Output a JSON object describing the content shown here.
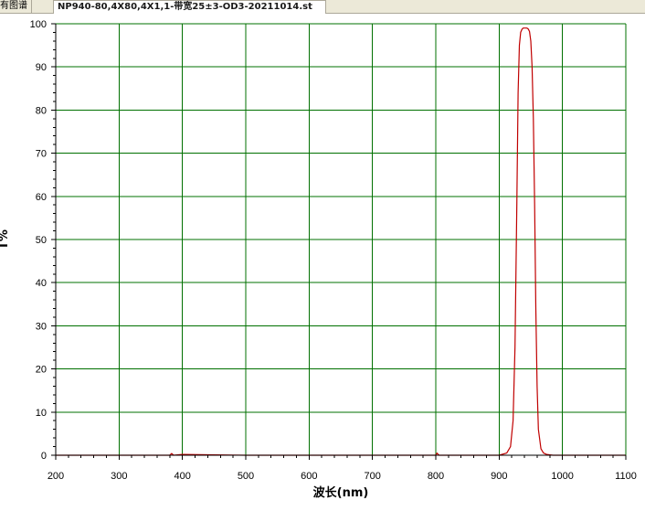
{
  "tabs": {
    "prev_tab_label": "有图谱",
    "active_tab_label": "NP940-80,4X80,4X1,1-带宽25±3-OD3-20211014.st"
  },
  "colors": {
    "grid": "#007000",
    "curve": "#c00000",
    "axis": "#000000"
  },
  "chart_data": {
    "type": "line",
    "title": "",
    "xlabel": "波长(nm)",
    "ylabel": "T%",
    "xlim": [
      200,
      1100
    ],
    "ylim": [
      0,
      100
    ],
    "x_ticks": [
      200,
      300,
      400,
      500,
      600,
      700,
      800,
      900,
      1000,
      1100
    ],
    "y_ticks": [
      0,
      10,
      20,
      30,
      40,
      50,
      60,
      70,
      80,
      90,
      100
    ],
    "grid": true,
    "series": [
      {
        "x": [
          200,
          300,
          380,
          383,
          386,
          400,
          500,
          600,
          700,
          800,
          802,
          805,
          900,
          912,
          918,
          922,
          925,
          928,
          930,
          932,
          934,
          936,
          938,
          940,
          942,
          944,
          946,
          948,
          950,
          952,
          954,
          956,
          958,
          960,
          962,
          966,
          970,
          975,
          985,
          1000,
          1100
        ],
        "y": [
          0,
          0,
          0,
          0.4,
          0,
          0.2,
          0,
          0,
          0,
          0,
          0.5,
          0,
          0,
          0.5,
          2,
          8,
          25,
          58,
          84,
          95,
          98,
          98.7,
          99,
          99,
          99,
          99,
          98.8,
          98.2,
          96,
          90,
          78,
          58,
          34,
          16,
          6,
          1.5,
          0.5,
          0.2,
          0,
          0,
          0
        ]
      }
    ]
  }
}
